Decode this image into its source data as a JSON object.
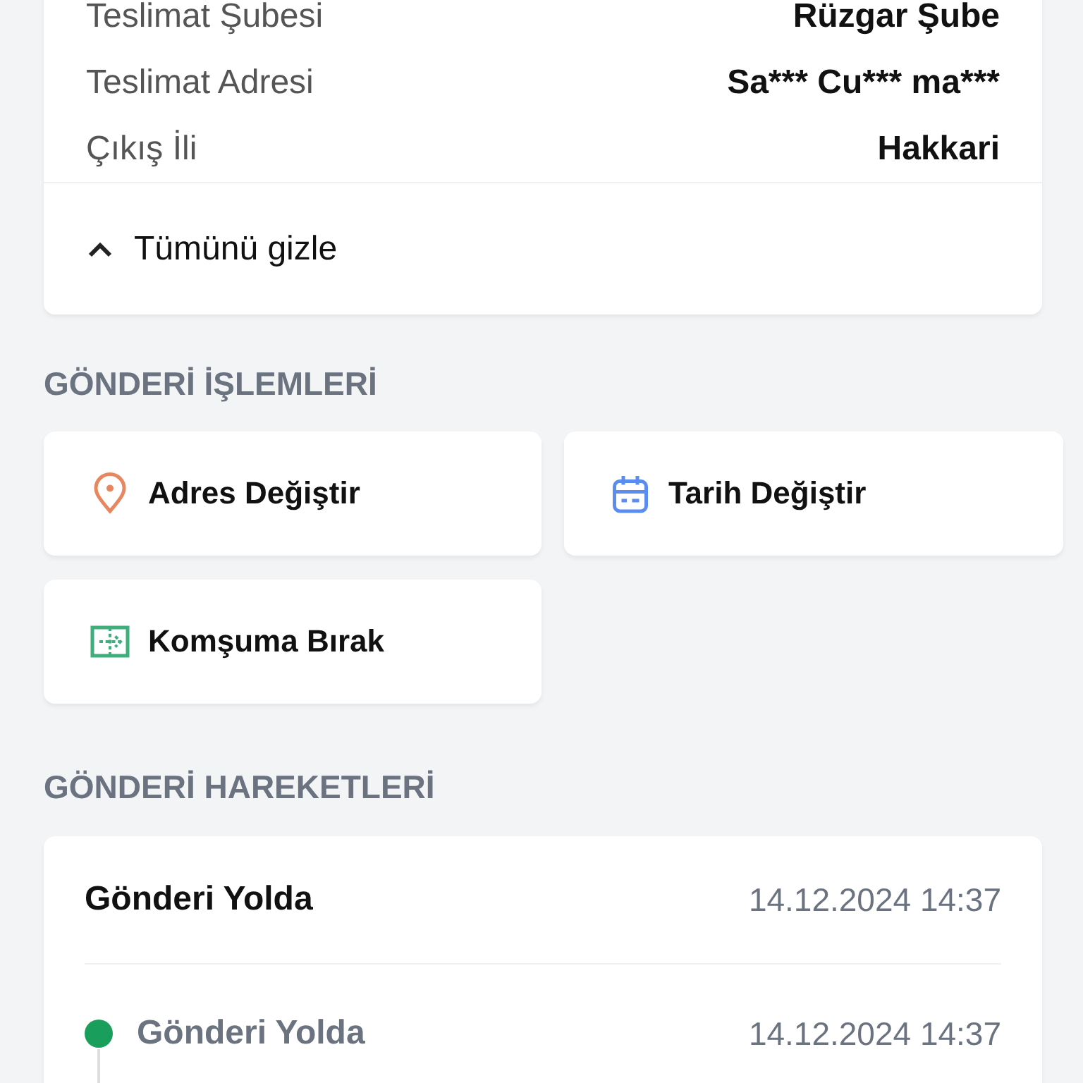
{
  "details": {
    "rows": [
      {
        "label": "Teslimat Şubesi",
        "value": "Rüzgar Şube"
      },
      {
        "label": "Teslimat Adresi",
        "value": "Sa*** Cu*** ma***"
      },
      {
        "label": "Çıkış İli",
        "value": "Hakkari"
      }
    ],
    "toggle": {
      "label": "Tümünü gizle",
      "expanded": true
    }
  },
  "actions": {
    "title": "GÖNDERİ İŞLEMLERİ",
    "buttons": [
      {
        "label": "Adres Değiştir",
        "kind": "address"
      },
      {
        "label": "Tarih Değiştir",
        "kind": "date"
      },
      {
        "label": "Komşuma Bırak",
        "kind": "neighbor"
      }
    ]
  },
  "history": {
    "title": "GÖNDERİ HAREKETLERİ",
    "status": "Gönderi Yolda",
    "time": "14.12.2024 14:37",
    "events": [
      {
        "label": "Gönderi Yolda",
        "time": "14.12.2024 14:37"
      }
    ]
  }
}
